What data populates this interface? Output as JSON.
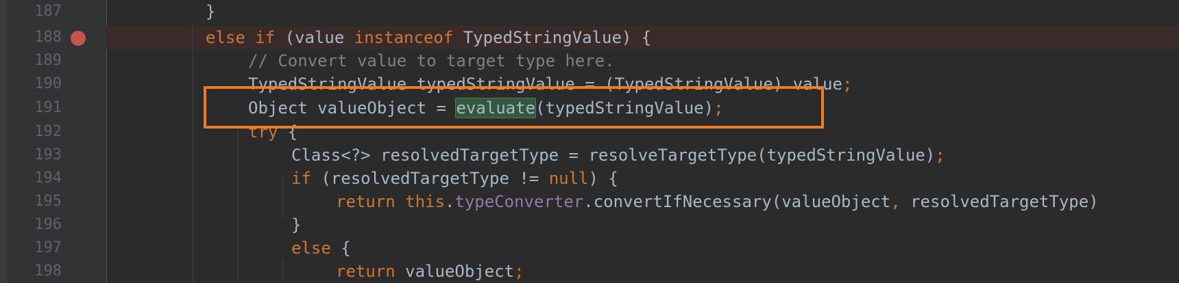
{
  "editor": {
    "lines": [
      {
        "number": "187",
        "tokens": [
          {
            "text": "}",
            "style": "plain"
          }
        ]
      },
      {
        "number": "188",
        "tokens": [
          {
            "text": "else ",
            "style": "kw"
          },
          {
            "text": "if ",
            "style": "kw"
          },
          {
            "text": "(value ",
            "style": "plain"
          },
          {
            "text": "instanceof ",
            "style": "kw"
          },
          {
            "text": "TypedStringValue) {",
            "style": "plain"
          }
        ]
      },
      {
        "number": "189",
        "tokens": [
          {
            "text": "// Convert value to target type here.",
            "style": "comment"
          }
        ]
      },
      {
        "number": "190",
        "tokens": [
          {
            "text": "TypedStringValue typedStringValue = (TypedStringValue) value",
            "style": "plain"
          },
          {
            "text": ";",
            "style": "kw"
          }
        ]
      },
      {
        "number": "191",
        "tokens": [
          {
            "text": "Object valueObject = ",
            "style": "plain"
          },
          {
            "text": "evaluate",
            "style": "highlight"
          },
          {
            "text": "(typedStringValue)",
            "style": "plain"
          },
          {
            "text": ";",
            "style": "kw"
          }
        ]
      },
      {
        "number": "192",
        "tokens": [
          {
            "text": "try ",
            "style": "kw"
          },
          {
            "text": "{",
            "style": "plain"
          }
        ]
      },
      {
        "number": "193",
        "tokens": [
          {
            "text": "Class<?> resolvedTargetType = resolveTargetType(typedStringValue)",
            "style": "plain"
          },
          {
            "text": ";",
            "style": "kw"
          }
        ]
      },
      {
        "number": "194",
        "tokens": [
          {
            "text": "if ",
            "style": "kw"
          },
          {
            "text": "(resolvedTargetType != ",
            "style": "plain"
          },
          {
            "text": "null",
            "style": "kw"
          },
          {
            "text": ") {",
            "style": "plain"
          }
        ]
      },
      {
        "number": "195",
        "tokens": [
          {
            "text": "return ",
            "style": "kw"
          },
          {
            "text": "this",
            "style": "kw"
          },
          {
            "text": ".",
            "style": "plain"
          },
          {
            "text": "typeConverter",
            "style": "field"
          },
          {
            "text": ".convertIfNecessary(valueObject",
            "style": "plain"
          },
          {
            "text": ", ",
            "style": "kw"
          },
          {
            "text": "resolvedTargetType)",
            "style": "plain"
          }
        ]
      },
      {
        "number": "196",
        "tokens": [
          {
            "text": "}",
            "style": "plain"
          }
        ]
      },
      {
        "number": "197",
        "tokens": [
          {
            "text": "else ",
            "style": "kw"
          },
          {
            "text": "{",
            "style": "plain"
          }
        ]
      },
      {
        "number": "198",
        "tokens": [
          {
            "text": "return ",
            "style": "kw"
          },
          {
            "text": "valueObject",
            "style": "plain"
          },
          {
            "text": ";",
            "style": "kw"
          }
        ]
      }
    ],
    "breakpoint_line": "188",
    "highlighted_line": "191"
  },
  "colors": {
    "background": "#2b2b2b",
    "keyword": "#cc7832",
    "comment": "#808080",
    "field": "#9876aa",
    "highlight_box": "#f07b22",
    "breakpoint": "#c75450"
  }
}
